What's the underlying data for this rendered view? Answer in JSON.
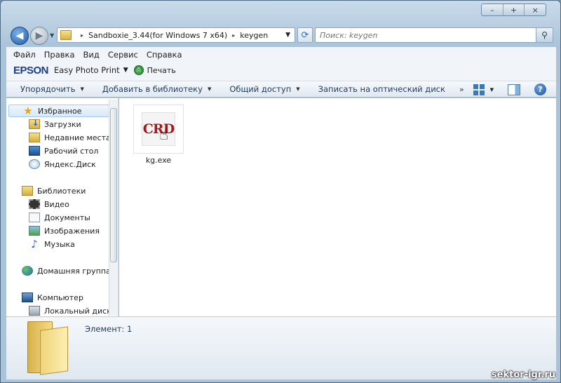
{
  "window": {
    "caption_buttons": [
      "–",
      "+",
      "×"
    ]
  },
  "address": {
    "crumbs": [
      "Sandboxie_3.44(for Windows 7 x64)",
      "keygen"
    ]
  },
  "search": {
    "placeholder": "Поиск: keygen"
  },
  "menu": {
    "items": [
      "Файл",
      "Правка",
      "Вид",
      "Сервис",
      "Справка"
    ]
  },
  "epson": {
    "brand": "EPSON",
    "app": "Easy Photo Print",
    "print": "Печать"
  },
  "command_bar": {
    "items": [
      "Упорядочить",
      "Добавить в библиотеку",
      "Общий доступ",
      "Записать на оптический диск"
    ],
    "more": "»"
  },
  "nav": {
    "favorites": "Избранное",
    "downloads": "Загрузки",
    "recent": "Недавние места",
    "desktop": "Рабочий стол",
    "yandex_disk": "Яндекс.Диск",
    "libraries": "Библиотеки",
    "video": "Видео",
    "documents": "Документы",
    "images": "Изображения",
    "music": "Музыка",
    "homegroup": "Домашняя группа",
    "computer": "Компьютер",
    "local_disk": "Локальный диск"
  },
  "files": [
    {
      "name": "kg.exe",
      "thumb_text": "CRD"
    }
  ],
  "details": {
    "count_text": "Элемент: 1"
  },
  "watermark": "sektor-igr.ru"
}
